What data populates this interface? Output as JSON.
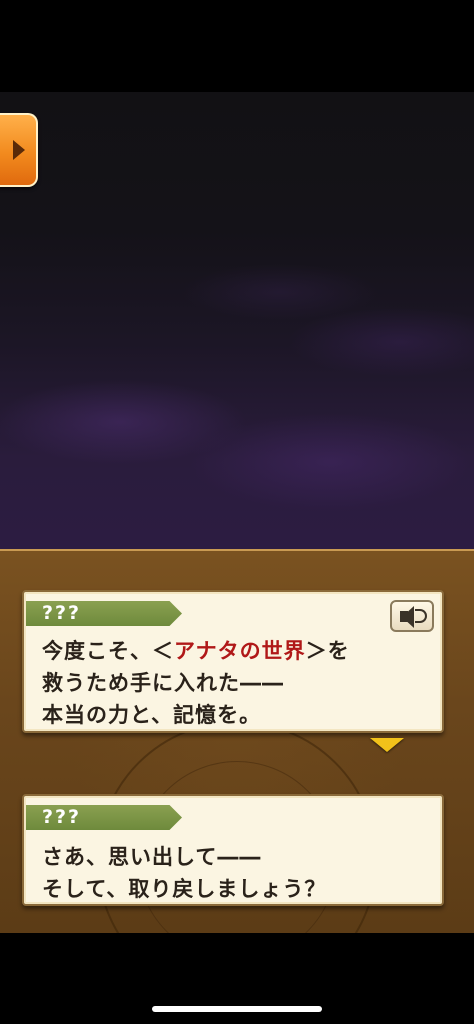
{
  "controls": {
    "skip_icon": "play-arrow"
  },
  "dialogs": [
    {
      "speaker": "???",
      "voice_icon": "speaker-icon",
      "lines": [
        {
          "before": "今度こそ、＜",
          "highlight": "アナタの世界",
          "after": "＞を"
        },
        {
          "text": "救うため手に入れた――"
        },
        {
          "text": "本当の力と、記憶を。"
        }
      ]
    },
    {
      "speaker": "???",
      "lines": [
        {
          "text": "さあ、思い出して――"
        },
        {
          "text": "そして、取り戻しましょう？"
        }
      ]
    }
  ],
  "colors": {
    "highlight": "#b01818",
    "speaker_tag": "#7a943f",
    "skip_tab": "#f28a1e",
    "next_arrow": "#f2c21a"
  }
}
